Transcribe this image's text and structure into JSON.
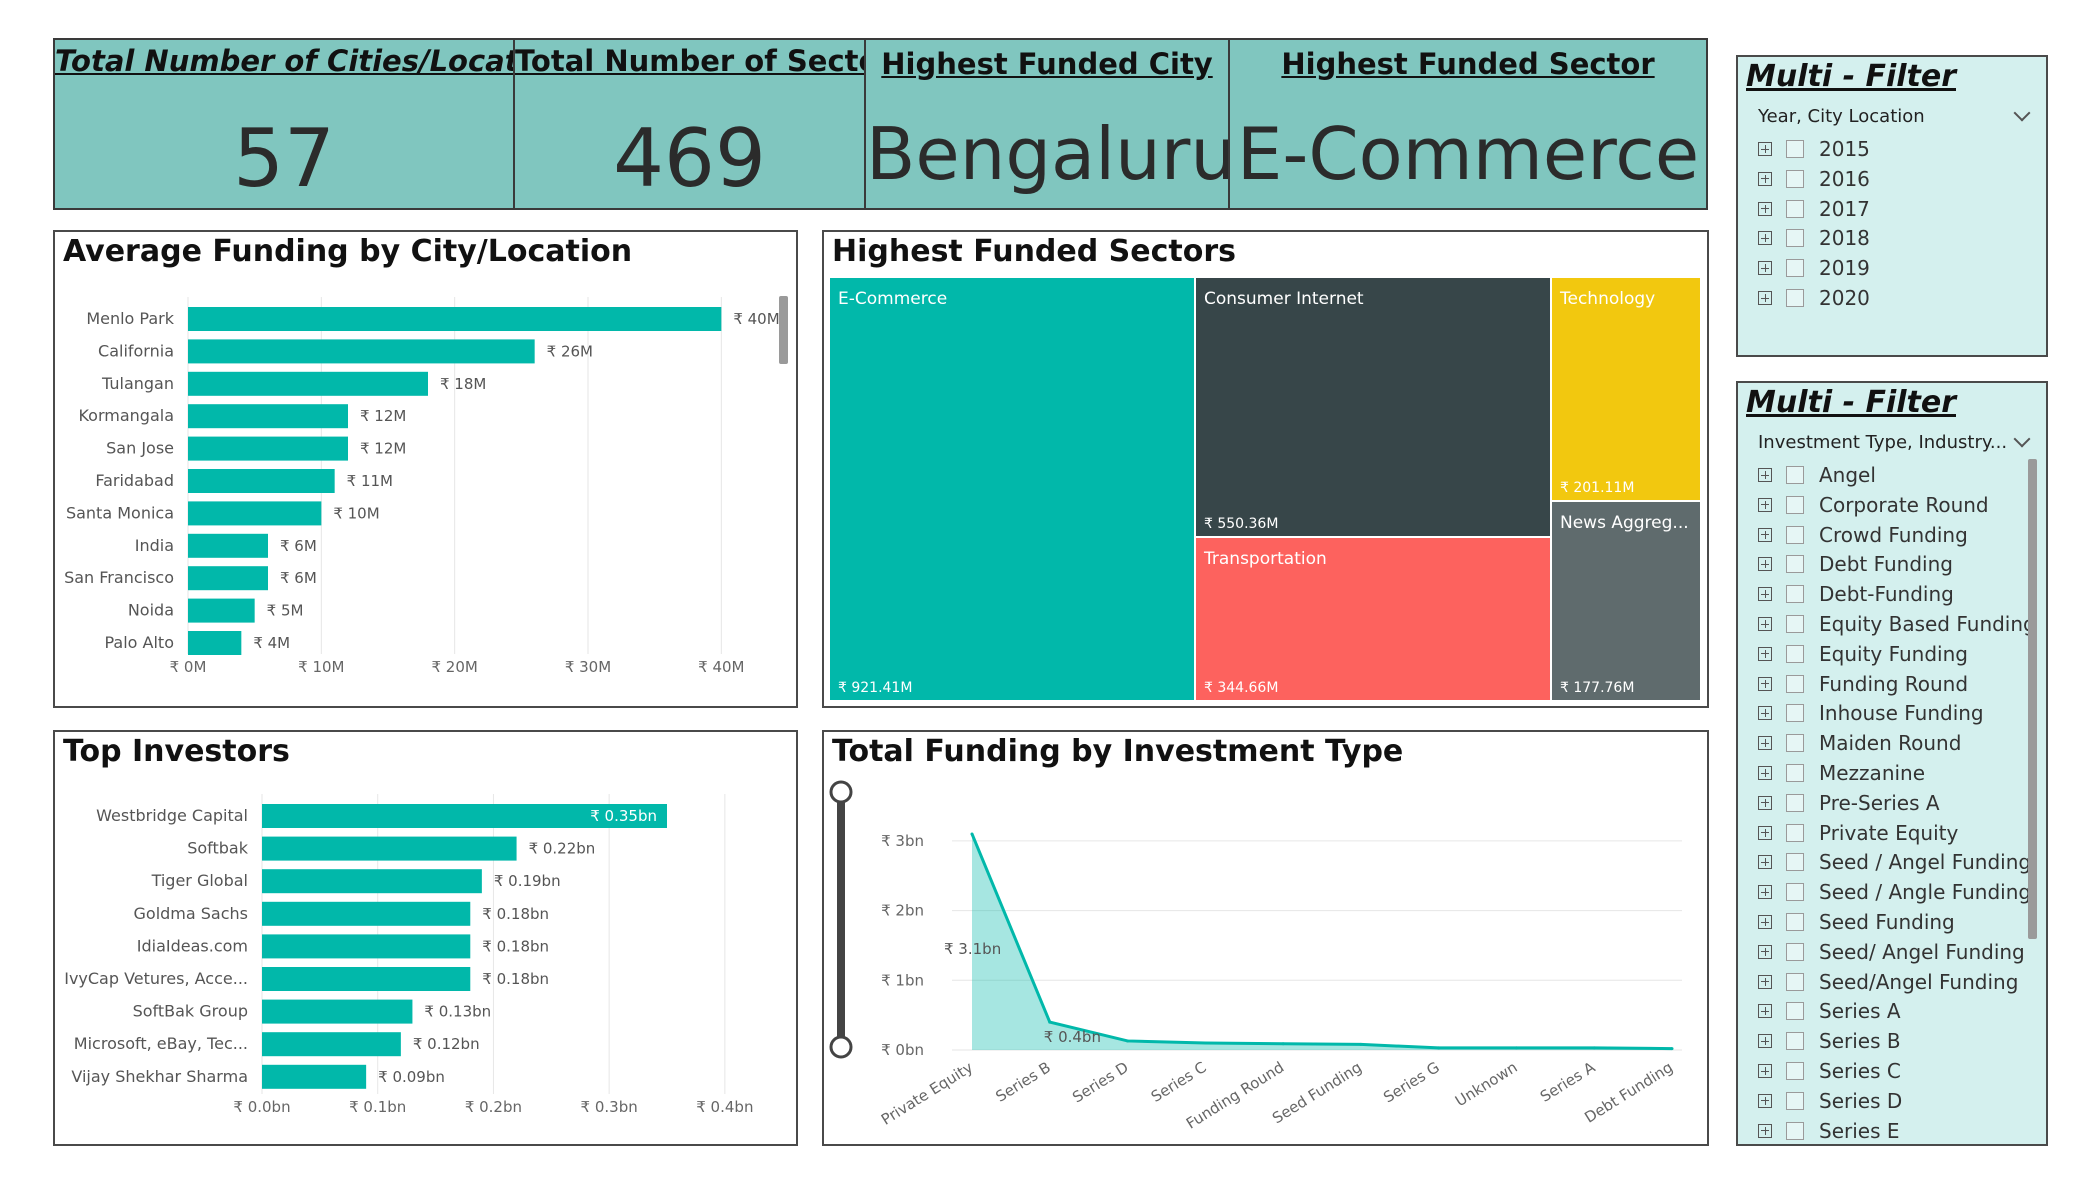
{
  "kpis": [
    {
      "title": "Total Number of Cities/Location",
      "value": "57"
    },
    {
      "title": "Total Number of Sector",
      "value": "469"
    },
    {
      "title": "Highest Funded City",
      "value": "Bengaluru"
    },
    {
      "title": "Highest Funded Sector",
      "value": "E-Commerce"
    }
  ],
  "avg_funding": {
    "title": "Average Funding by City/Location",
    "chart_data": {
      "type": "bar",
      "orientation": "horizontal",
      "categories": [
        "Menlo Park",
        "California",
        "Tulangan",
        "Kormangala",
        "San Jose",
        "Faridabad",
        "Santa Monica",
        "India",
        "San Francisco",
        "Noida",
        "Palo Alto"
      ],
      "values": [
        40,
        26,
        18,
        12,
        12,
        11,
        10,
        6,
        6,
        5,
        4
      ],
      "value_labels": [
        "₹ 40M",
        "₹ 26M",
        "₹ 18M",
        "₹ 12M",
        "₹ 12M",
        "₹ 11M",
        "₹ 10M",
        "₹ 6M",
        "₹ 6M",
        "₹ 5M",
        "₹ 4M"
      ],
      "xticks": [
        "₹ 0M",
        "₹ 10M",
        "₹ 20M",
        "₹ 30M",
        "₹ 40M"
      ],
      "xlim": [
        0,
        42
      ],
      "grid": true,
      "color": "#01b8aa"
    }
  },
  "sectors": {
    "title": "Highest Funded Sectors",
    "chart_data": {
      "type": "treemap",
      "items": [
        {
          "name": "E-Commerce",
          "value": "₹ 921.41M",
          "color": "#01b8aa"
        },
        {
          "name": "Consumer Internet",
          "value": "₹ 550.36M",
          "color": "#374649"
        },
        {
          "name": "Technology",
          "value": "₹ 201.11M",
          "color": "#f2c80f"
        },
        {
          "name": "Transportation",
          "value": "₹ 344.66M",
          "color": "#fd625e"
        },
        {
          "name": "News Aggreg...",
          "value": "₹ 177.76M",
          "color": "#5f6b6d"
        }
      ]
    }
  },
  "investors": {
    "title": "Top Investors",
    "chart_data": {
      "type": "bar",
      "orientation": "horizontal",
      "categories": [
        "Westbridge Capital",
        "Softbak",
        "Tiger Global",
        "Goldma Sachs",
        "IdiaIdeas.com",
        "IvyCap Vetures, Acce...",
        "SoftBak Group",
        "Microsoft, eBay, Tec...",
        "Vijay Shekhar Sharma"
      ],
      "values": [
        0.35,
        0.22,
        0.19,
        0.18,
        0.18,
        0.18,
        0.13,
        0.12,
        0.09
      ],
      "value_labels": [
        "₹ 0.35bn",
        "₹ 0.22bn",
        "₹ 0.19bn",
        "₹ 0.18bn",
        "₹ 0.18bn",
        "₹ 0.18bn",
        "₹ 0.13bn",
        "₹ 0.12bn",
        "₹ 0.09bn"
      ],
      "xticks": [
        "₹ 0.0bn",
        "₹ 0.1bn",
        "₹ 0.2bn",
        "₹ 0.3bn",
        "₹ 0.4bn"
      ],
      "xlim": [
        0,
        0.42
      ],
      "grid": true,
      "color": "#01b8aa"
    }
  },
  "investment_type": {
    "title": "Total Funding by Investment Type",
    "chart_data": {
      "type": "area",
      "categories": [
        "Private Equity",
        "Series B",
        "Series D",
        "Series C",
        "Funding Round",
        "Seed Funding",
        "Series G",
        "Unknown",
        "Series A",
        "Debt Funding"
      ],
      "values": [
        3.1,
        0.4,
        0.13,
        0.1,
        0.09,
        0.08,
        0.03,
        0.03,
        0.03,
        0.02
      ],
      "point_labels": [
        "₹ 3.1bn",
        "₹ 0.4bn",
        "",
        "",
        "",
        "",
        "",
        "",
        "",
        ""
      ],
      "yticks": [
        "₹ 0bn",
        "₹ 1bn",
        "₹ 2bn",
        "₹ 3bn"
      ],
      "ylim": [
        0,
        3.3
      ],
      "grid": true,
      "color": "#01b8aa"
    }
  },
  "filter1": {
    "title": "Multi - Filter",
    "field": "Year, City Location",
    "items": [
      "2015",
      "2016",
      "2017",
      "2018",
      "2019",
      "2020"
    ]
  },
  "filter2": {
    "title": "Multi - Filter",
    "field": "Investment Type, Industry...",
    "items": [
      "Angel",
      "Corporate Round",
      "Crowd Funding",
      "Debt Funding",
      "Debt-Funding",
      "Equity Based Funding",
      "Equity Funding",
      "Funding Round",
      "Inhouse Funding",
      "Maiden Round",
      "Mezzanine",
      "Pre-Series A",
      "Private Equity",
      "Seed / Angel Funding",
      "Seed / Angle Funding",
      "Seed Funding",
      "Seed/ Angel Funding",
      "Seed/Angel Funding",
      "Series A",
      "Series B",
      "Series C",
      "Series D",
      "Series E"
    ]
  }
}
